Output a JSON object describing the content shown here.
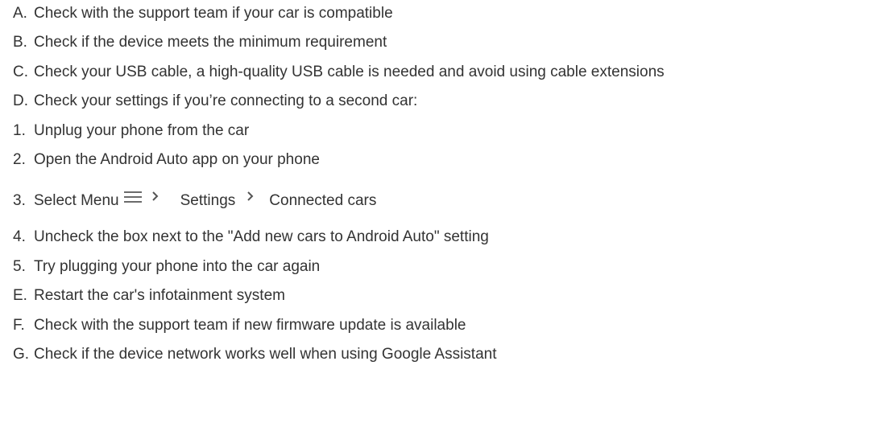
{
  "items": [
    {
      "marker": "A.",
      "text": "Check with the support team if your car is compatible"
    },
    {
      "marker": "B.",
      "text": "Check if the device meets the minimum requirement"
    },
    {
      "marker": "C.",
      "text": "Check your USB cable, a high-quality USB cable is needed and avoid using cable extensions"
    },
    {
      "marker": "D.",
      "text": "Check your settings if you’re connecting to a second car:"
    },
    {
      "marker": "1.",
      "text": "Unplug your phone from the car"
    },
    {
      "marker": "2.",
      "text": "Open the Android Auto app on your phone"
    },
    {
      "marker": "3.",
      "parts": [
        "Select Menu",
        "Settings",
        "Connected cars"
      ]
    },
    {
      "marker": "4.",
      "text": "Uncheck the box next to the \"Add new cars to Android Auto\" setting"
    },
    {
      "marker": "5.",
      "text": "Try plugging your phone into the car again"
    },
    {
      "marker": "E.",
      "text": "Restart the car's infotainment system"
    },
    {
      "marker": "F.",
      "text": "Check with the support team if new firmware update is available"
    },
    {
      "marker": "G.",
      "text": "Check if the device network works well when using Google Assistant"
    }
  ],
  "icons": {
    "menu": "hamburger-menu-icon",
    "chevron": "chevron-right-icon"
  }
}
